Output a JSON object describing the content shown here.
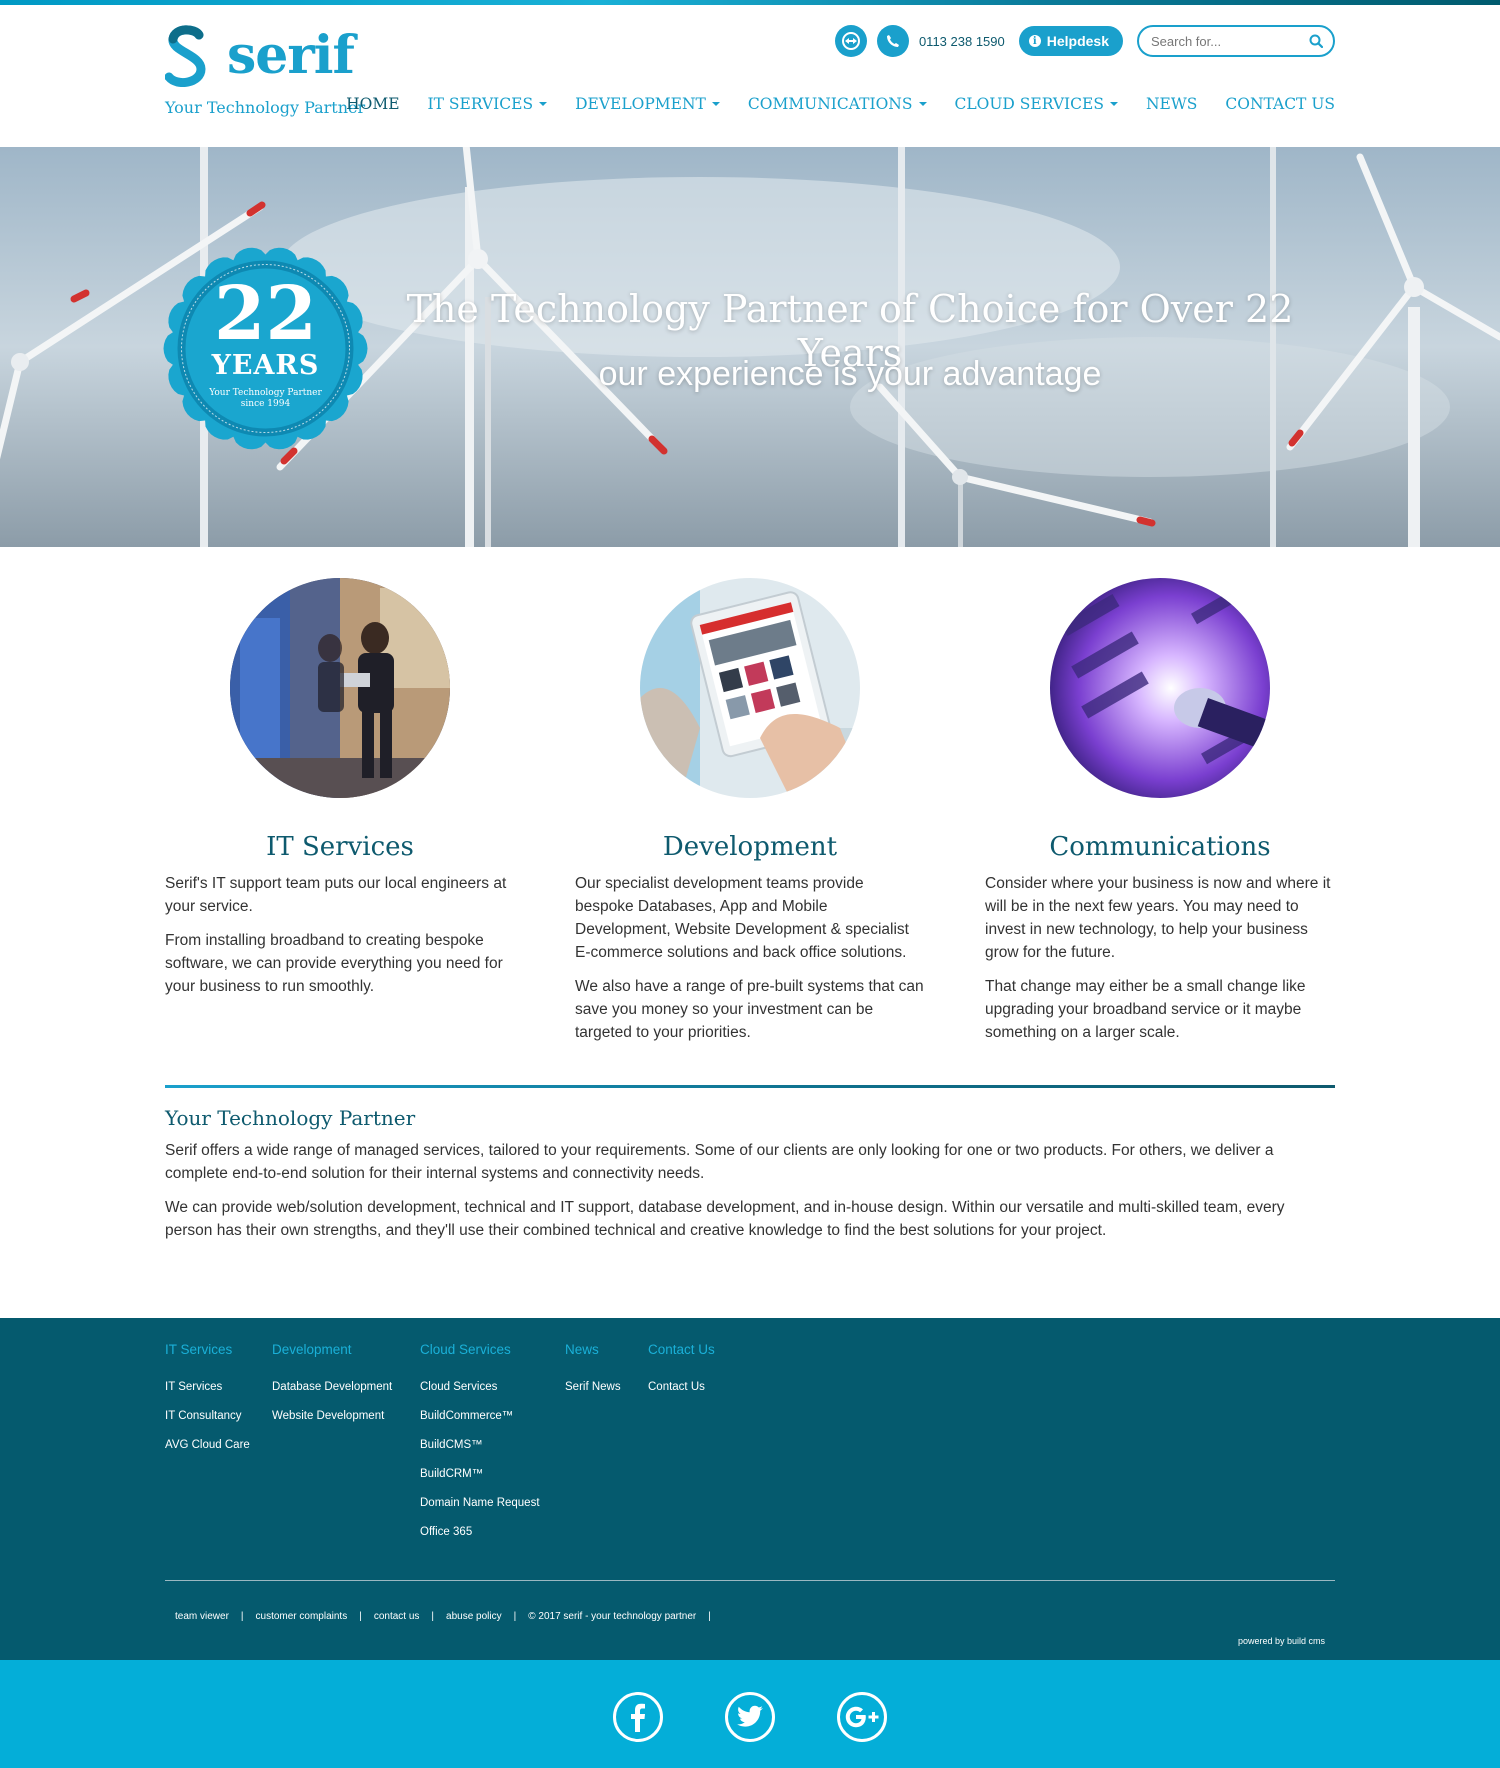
{
  "header": {
    "logo_text": "serif",
    "tagline": "Your Technology Partner",
    "phone": "0113 238 1590",
    "helpdesk_label": "Helpdesk",
    "search_placeholder": "Search for..."
  },
  "nav": {
    "items": [
      {
        "label": "HOME",
        "active": true
      },
      {
        "label": "IT SERVICES",
        "dropdown": true
      },
      {
        "label": "DEVELOPMENT",
        "dropdown": true
      },
      {
        "label": "COMMUNICATIONS",
        "dropdown": true
      },
      {
        "label": "CLOUD SERVICES",
        "dropdown": true
      },
      {
        "label": "NEWS"
      },
      {
        "label": "CONTACT US"
      }
    ]
  },
  "hero": {
    "badge_number": "22",
    "badge_years": "YEARS",
    "badge_line1": "Your Technology Partner",
    "badge_line2": "since 1994",
    "title": "The Technology Partner of Choice for Over 22 Years",
    "subtitle": "our experience is your advantage"
  },
  "services": [
    {
      "title": "IT Services",
      "paragraphs": [
        "Serif's IT support team puts our local engineers at your service.",
        "From installing broadband to creating bespoke software, we can provide everything you need for your business to run smoothly."
      ]
    },
    {
      "title": "Development",
      "paragraphs": [
        "Our specialist development teams provide bespoke Databases, App and Mobile Development, Website Development & specialist E-commerce solutions and back office solutions.",
        "We also have a range of pre-built systems that can save you money so your investment can be targeted to your priorities."
      ]
    },
    {
      "title": "Communications",
      "paragraphs": [
        "Consider where your business is now and where it will be in the next few years. You may need to invest in new technology, to help your business grow for the future.",
        "That change may either be a small change like upgrading your broadband service or it maybe something on a larger scale."
      ]
    }
  ],
  "about": {
    "title": "Your Technology Partner",
    "paragraphs": [
      "Serif offers a wide range of managed services, tailored to your requirements. Some of our clients are only looking for one or two products. For others, we deliver a complete end-to-end solution for their internal systems and connectivity needs.",
      "We can provide web/solution development, technical and IT support, database development, and in-house design. Within our versatile and multi-skilled team, every person has their own strengths, and they'll use their combined technical and creative knowledge to find the best solutions for your project."
    ]
  },
  "footer": {
    "columns": [
      {
        "head": "IT Services",
        "links": [
          "IT Services",
          "IT Consultancy",
          "AVG Cloud Care"
        ]
      },
      {
        "head": "Development",
        "links": [
          "Database Development",
          "Website Development"
        ]
      },
      {
        "head": "Cloud Services",
        "links": [
          "Cloud Services",
          "BuildCommerce™",
          "BuildCMS™",
          "BuildCRM™",
          "Domain Name Request",
          "Office 365"
        ]
      },
      {
        "head": "News",
        "links": [
          "Serif News"
        ]
      },
      {
        "head": "Contact Us",
        "links": [
          "Contact Us"
        ]
      }
    ],
    "bottom_links": [
      "team viewer",
      "customer complaints",
      "contact us",
      "abuse policy",
      "© 2017 serif - your technology partner"
    ],
    "powered": "powered by build cms"
  },
  "social": [
    "facebook-icon",
    "twitter-icon",
    "google-plus-icon"
  ],
  "colors": {
    "brand": "#1aa0cc",
    "dark": "#0e5a6e",
    "footer": "#055a6e",
    "social_bar": "#04aed8"
  }
}
